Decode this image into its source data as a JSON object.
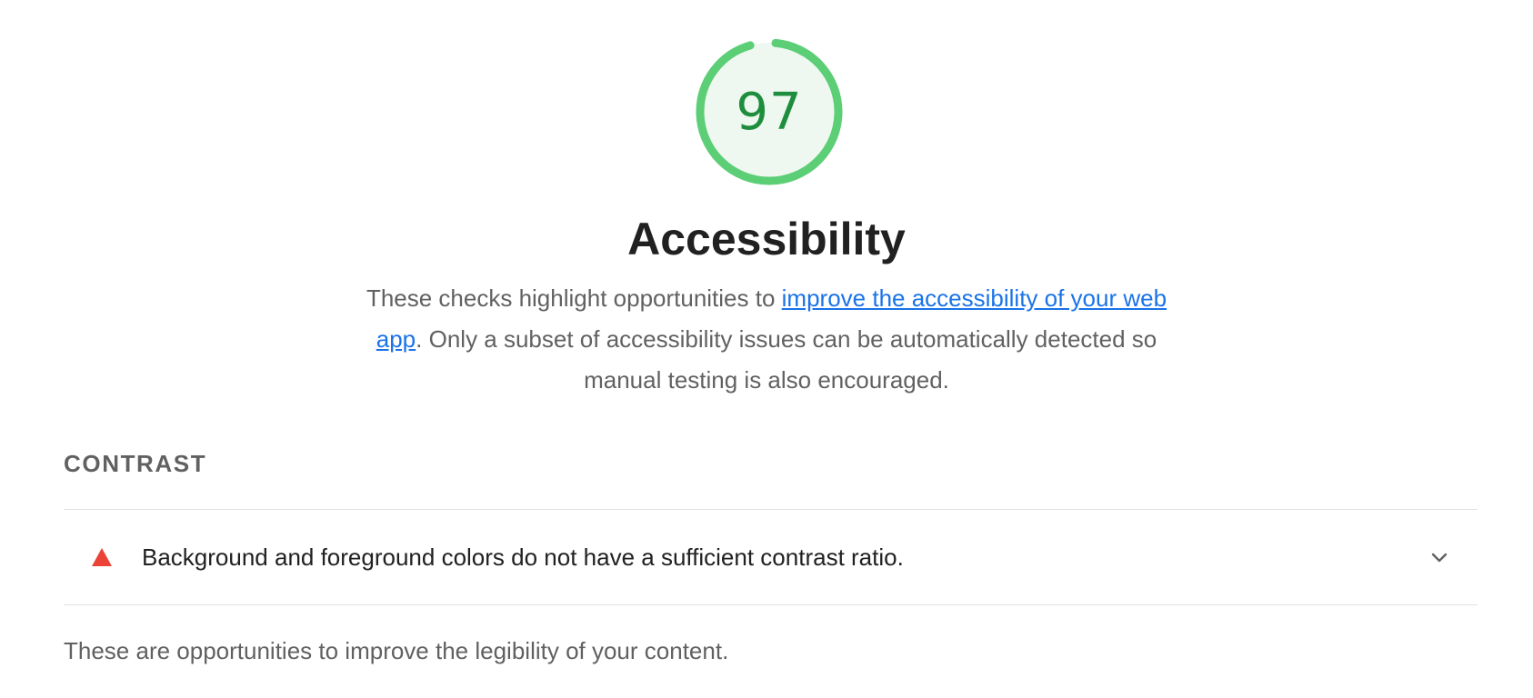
{
  "category": {
    "score": "97",
    "score_fraction": 0.97,
    "score_color": "#1e8e3e",
    "ring_color": "#5cce76",
    "ring_fill": "#eef8f0",
    "title": "Accessibility",
    "description": {
      "before_link": "These checks highlight opportunities to ",
      "link_text": "improve the accessibility of your web app",
      "after_link": ". Only a subset of accessibility issues can be automatically detected so manual testing is also encouraged."
    }
  },
  "group": {
    "title": "CONTRAST",
    "description": "These are opportunities to improve the legibility of your content."
  },
  "audits": [
    {
      "icon": "fail-triangle-icon",
      "icon_color": "#eb4335",
      "title": "Background and foreground colors do not have a sufficient contrast ratio.",
      "expand_icon": "chevron-down-icon"
    }
  ]
}
